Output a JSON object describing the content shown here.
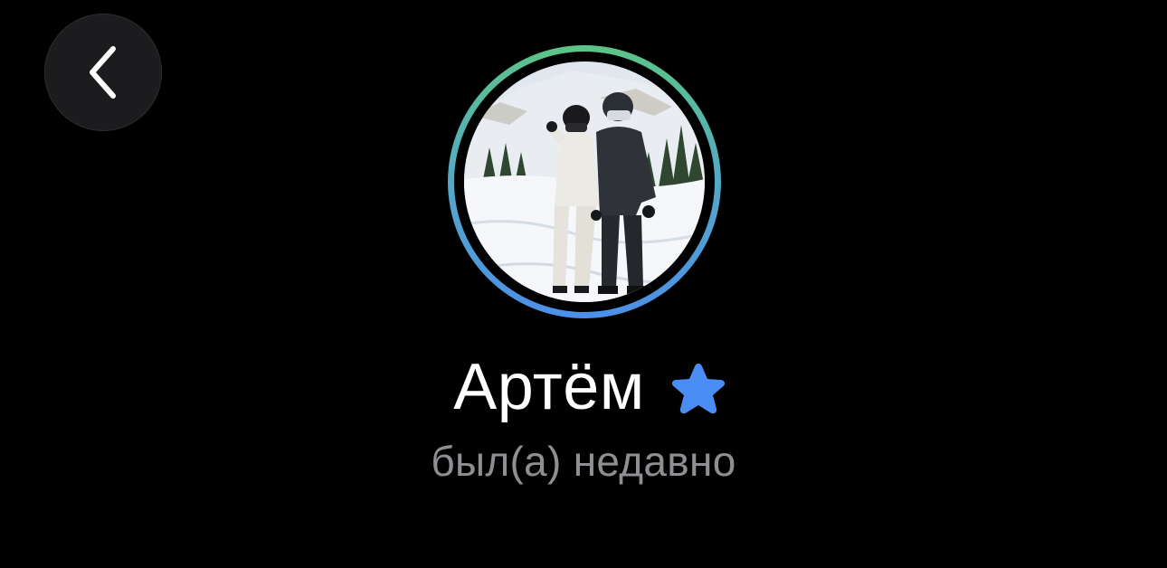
{
  "header": {
    "back_icon": "chevron-left-icon"
  },
  "profile": {
    "name": "Артём",
    "status": "был(а) недавно",
    "badge_icon": "star-icon",
    "avatar_icon": "profile-photo",
    "colors": {
      "ring_top": "#5cc486",
      "ring_bottom": "#4d8fe8",
      "badge": "#4a8ef5",
      "status_text": "#8e8e93",
      "background": "#000000"
    }
  }
}
